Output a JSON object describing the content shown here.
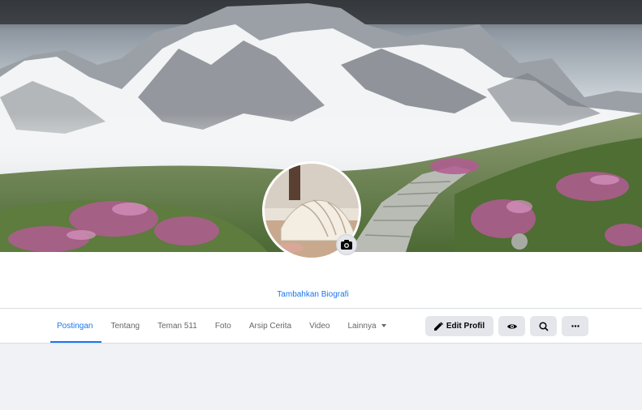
{
  "cover": {
    "alt_subject": "mountain landscape"
  },
  "profile": {
    "bio_link": "Tambahkan Biografi",
    "camera_icon": "camera-icon"
  },
  "tabs": [
    {
      "label": "Postingan",
      "active": true
    },
    {
      "label": "Tentang"
    },
    {
      "label": "Teman 511"
    },
    {
      "label": "Foto"
    },
    {
      "label": "Arsip Cerita"
    },
    {
      "label": "Video"
    },
    {
      "label": "Lainnya",
      "icon": "caret-down-icon"
    }
  ],
  "actions": {
    "edit_label": "Edit Profil",
    "edit_icon": "pencil-icon",
    "view_icon": "eye-icon",
    "search_icon": "search-icon",
    "more_icon": "more-icon"
  },
  "colors": {
    "accent": "#1877f2",
    "page_bg": "#f0f2f5",
    "button_bg": "#e4e6eb"
  }
}
